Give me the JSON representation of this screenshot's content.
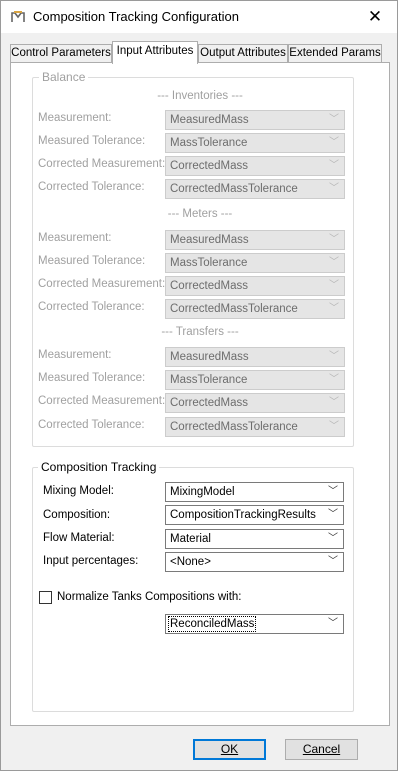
{
  "window": {
    "title": "Composition Tracking Configuration",
    "close_symbol": "✕"
  },
  "tabs": [
    {
      "label": "Control Parameters",
      "active": false
    },
    {
      "label": "Input Attributes",
      "active": true
    },
    {
      "label": "Output Attributes",
      "active": false
    },
    {
      "label": "Extended Params",
      "active": false
    }
  ],
  "balance": {
    "title": "Balance",
    "sections": [
      {
        "header": "--- Inventories ---",
        "rows": [
          {
            "label": "Measurement:",
            "value": "MeasuredMass"
          },
          {
            "label": "Measured Tolerance:",
            "value": "MassTolerance"
          },
          {
            "label": "Corrected Measurement:",
            "value": "CorrectedMass"
          },
          {
            "label": "Corrected Tolerance:",
            "value": "CorrectedMassTolerance"
          }
        ]
      },
      {
        "header": "--- Meters ---",
        "rows": [
          {
            "label": "Measurement:",
            "value": "MeasuredMass"
          },
          {
            "label": "Measured Tolerance:",
            "value": "MassTolerance"
          },
          {
            "label": "Corrected Measurement:",
            "value": "CorrectedMass"
          },
          {
            "label": "Corrected Tolerance:",
            "value": "CorrectedMassTolerance"
          }
        ]
      },
      {
        "header": "--- Transfers ---",
        "rows": [
          {
            "label": "Measurement:",
            "value": "MeasuredMass"
          },
          {
            "label": "Measured Tolerance:",
            "value": "MassTolerance"
          },
          {
            "label": "Corrected Measurement:",
            "value": "CorrectedMass"
          },
          {
            "label": "Corrected Tolerance:",
            "value": "CorrectedMassTolerance"
          }
        ]
      }
    ]
  },
  "composition_tracking": {
    "title": "Composition Tracking",
    "mixing_model_label": "Mixing Model:",
    "mixing_model_value": "MixingModel",
    "composition_label": "Composition:",
    "composition_value": "CompositionTrackingResults",
    "flow_material_label": "Flow Material:",
    "flow_material_value": "Material",
    "input_percentages_label": "Input percentages:",
    "input_percentages_value": "<None>",
    "normalize_label": "Normalize Tanks Compositions with:",
    "normalize_checked": false,
    "normalize_value": "ReconciledMass"
  },
  "buttons": {
    "ok_label": "OK",
    "cancel_label": "Cancel"
  },
  "icons": {
    "app": "app-logo-icon",
    "close": "close-icon",
    "dropdown": "chevron-down-icon"
  }
}
